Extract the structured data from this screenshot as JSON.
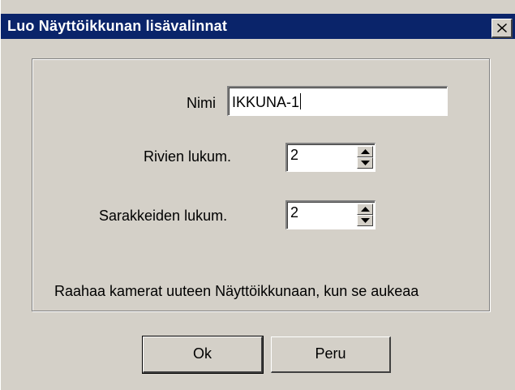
{
  "dialog": {
    "title": "Luo Näyttöikkunan lisävalinnat",
    "close_glyph": "✕"
  },
  "form": {
    "name_label": "Nimi",
    "name_value": "IKKUNA-1",
    "rows_label": "Rivien lukum.",
    "rows_value": "2",
    "cols_label": "Sarakkeiden lukum.",
    "cols_value": "2",
    "hint": "Raahaa kamerat uuteen Näyttöikkunaan, kun se aukeaa"
  },
  "buttons": {
    "ok_label": "Ok",
    "cancel_label": "Peru"
  },
  "colors": {
    "titlebar": "#0a246a",
    "face": "#d4d0c8"
  }
}
